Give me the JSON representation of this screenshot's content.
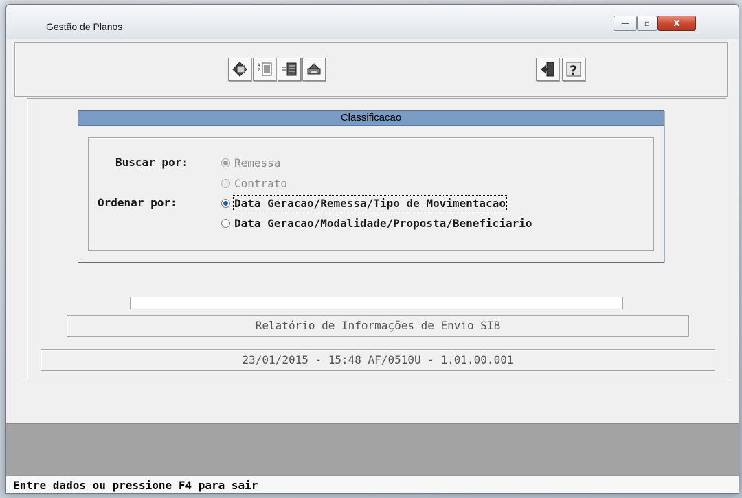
{
  "window": {
    "title": "Gestão de Planos",
    "controls": {
      "minimize": "—",
      "maximize": "▫",
      "close": "X"
    }
  },
  "toolbar": {
    "buttons": [
      {
        "icon": "cancel-icon"
      },
      {
        "icon": "sort-list-icon"
      },
      {
        "icon": "list-select-icon"
      },
      {
        "icon": "print-icon"
      },
      {
        "icon": "exit-icon"
      },
      {
        "icon": "help-icon"
      }
    ]
  },
  "dialog": {
    "title": "Classificacao",
    "search_label": "Buscar por:",
    "search_options": [
      {
        "label": "Remessa",
        "selected": true,
        "enabled": false
      },
      {
        "label": "Contrato",
        "selected": false,
        "enabled": false
      }
    ],
    "order_label": "Ordenar por:",
    "order_options": [
      {
        "label": "Data Geracao/Remessa/Tipo de Movimentacao",
        "selected": true
      },
      {
        "label": "Data Geracao/Modalidade/Proposta/Beneficiario",
        "selected": false
      }
    ]
  },
  "report_title": "Relatório de Informações de Envio SIB",
  "version_info": "23/01/2015 - 15:48  AF/0510U - 1.01.00.001",
  "status_message": "Entre dados ou pressione F4 para sair",
  "colors": {
    "dialog_header": "#7a9cc4",
    "gray_bar": "#a3a3a3",
    "close_button": "#cc4a33"
  }
}
